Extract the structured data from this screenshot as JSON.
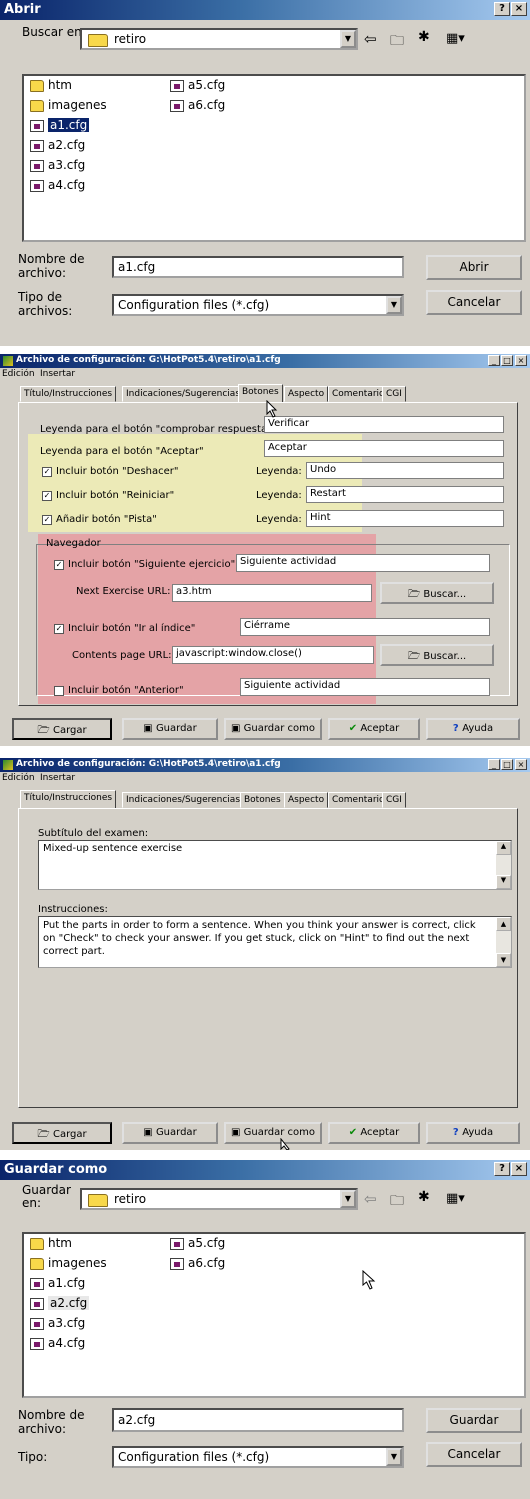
{
  "abrir": {
    "title": "Abrir",
    "help_label": "?",
    "close_label": "×",
    "look_in_label": "Buscar en:",
    "look_in_value": "retiro",
    "file_list": {
      "col1": [
        "htm",
        "imagenes",
        "a1.cfg",
        "a2.cfg",
        "a3.cfg",
        "a4.cfg"
      ],
      "col1_types": [
        "folder",
        "folder",
        "cfg",
        "cfg",
        "cfg",
        "cfg"
      ],
      "col2": [
        "a5.cfg",
        "a6.cfg"
      ],
      "selected": "a1.cfg"
    },
    "filename_label": "Nombre de archivo:",
    "filename_value": "a1.cfg",
    "filetype_label": "Tipo de archivos:",
    "filetype_value": "Configuration files (*.cfg)",
    "open_button": "Abrir",
    "cancel_button": "Cancelar"
  },
  "config1": {
    "title": "Archivo de configuración: G:\\HotPot5.4\\retiro\\a1.cfg",
    "menu": [
      "Edición",
      "Insertar"
    ],
    "tabs": [
      "Título/Instrucciones",
      "Indicaciones/Sugerencias",
      "Botones",
      "Aspecto",
      "Comentario",
      "CGI"
    ],
    "active_tab": "Botones",
    "check_label": "Leyenda para el botón \"comprobar respuesta\"",
    "check_value": "Verificar",
    "accept_label": "Leyenda para el botón \"Aceptar\"",
    "accept_value": "Aceptar",
    "legend_label": "Leyenda:",
    "undo_label": "Incluir botón \"Deshacer\"",
    "undo_value": "Undo",
    "restart_label": "Incluir botón \"Reiniciar\"",
    "restart_value": "Restart",
    "hint_label": "Añadir botón \"Pista\"",
    "hint_value": "Hint",
    "nav_group": "Navegador",
    "next_label": "Incluir botón \"Siguiente ejercicio\"",
    "next_value": "Siguiente actividad",
    "next_url_label": "Next Exercise URL:",
    "next_url_value": "a3.htm",
    "browse_label": "Buscar...",
    "index_label": "Incluir botón \"Ir al índice\"",
    "index_value": "Ciérrame",
    "contents_label": "Contents page URL:",
    "contents_value": "javascript:window.close()",
    "prev_label": "Incluir botón \"Anterior\"",
    "prev_value": "Siguiente actividad",
    "buttons": [
      "Cargar",
      "Guardar",
      "Guardar como",
      "Aceptar",
      "Ayuda"
    ]
  },
  "config2": {
    "title": "Archivo de configuración: G:\\HotPot5.4\\retiro\\a1.cfg",
    "menu": [
      "Edición",
      "Insertar"
    ],
    "tabs": [
      "Título/Instrucciones",
      "Indicaciones/Sugerencias",
      "Botones",
      "Aspecto",
      "Comentario",
      "CGI"
    ],
    "active_tab": "Título/Instrucciones",
    "subtitle_label": "Subtítulo del examen:",
    "subtitle_value": "Mixed-up sentence exercise",
    "instructions_label": "Instrucciones:",
    "instructions_value": "Put the parts in order to form a sentence. When you think your answer is correct, click on \"Check\" to check your answer. If you get stuck, click on \"Hint\" to find out the next correct part.",
    "buttons": [
      "Cargar",
      "Guardar",
      "Guardar como",
      "Aceptar",
      "Ayuda"
    ]
  },
  "saveas": {
    "title": "Guardar como",
    "help_label": "?",
    "close_label": "×",
    "look_in_label": "Guardar en:",
    "look_in_value": "retiro",
    "file_list": {
      "col1": [
        "htm",
        "imagenes",
        "a1.cfg",
        "a2.cfg",
        "a3.cfg",
        "a4.cfg"
      ],
      "col2": [
        "a5.cfg",
        "a6.cfg"
      ],
      "highlighted": "a2.cfg"
    },
    "filename_label": "Nombre de archivo:",
    "filename_value": "a2.cfg",
    "filetype_label": "Tipo:",
    "filetype_value": "Configuration files (*.cfg)",
    "save_button": "Guardar",
    "cancel_button": "Cancelar"
  },
  "colors": {
    "titlebar_dark": "#0a246a",
    "titlebar_light": "#a6caf0",
    "window_face": "#d4d0c8",
    "selection": "#0a246a",
    "highlight_yellow": "#ffffaa",
    "highlight_red": "#ff5a6e"
  }
}
